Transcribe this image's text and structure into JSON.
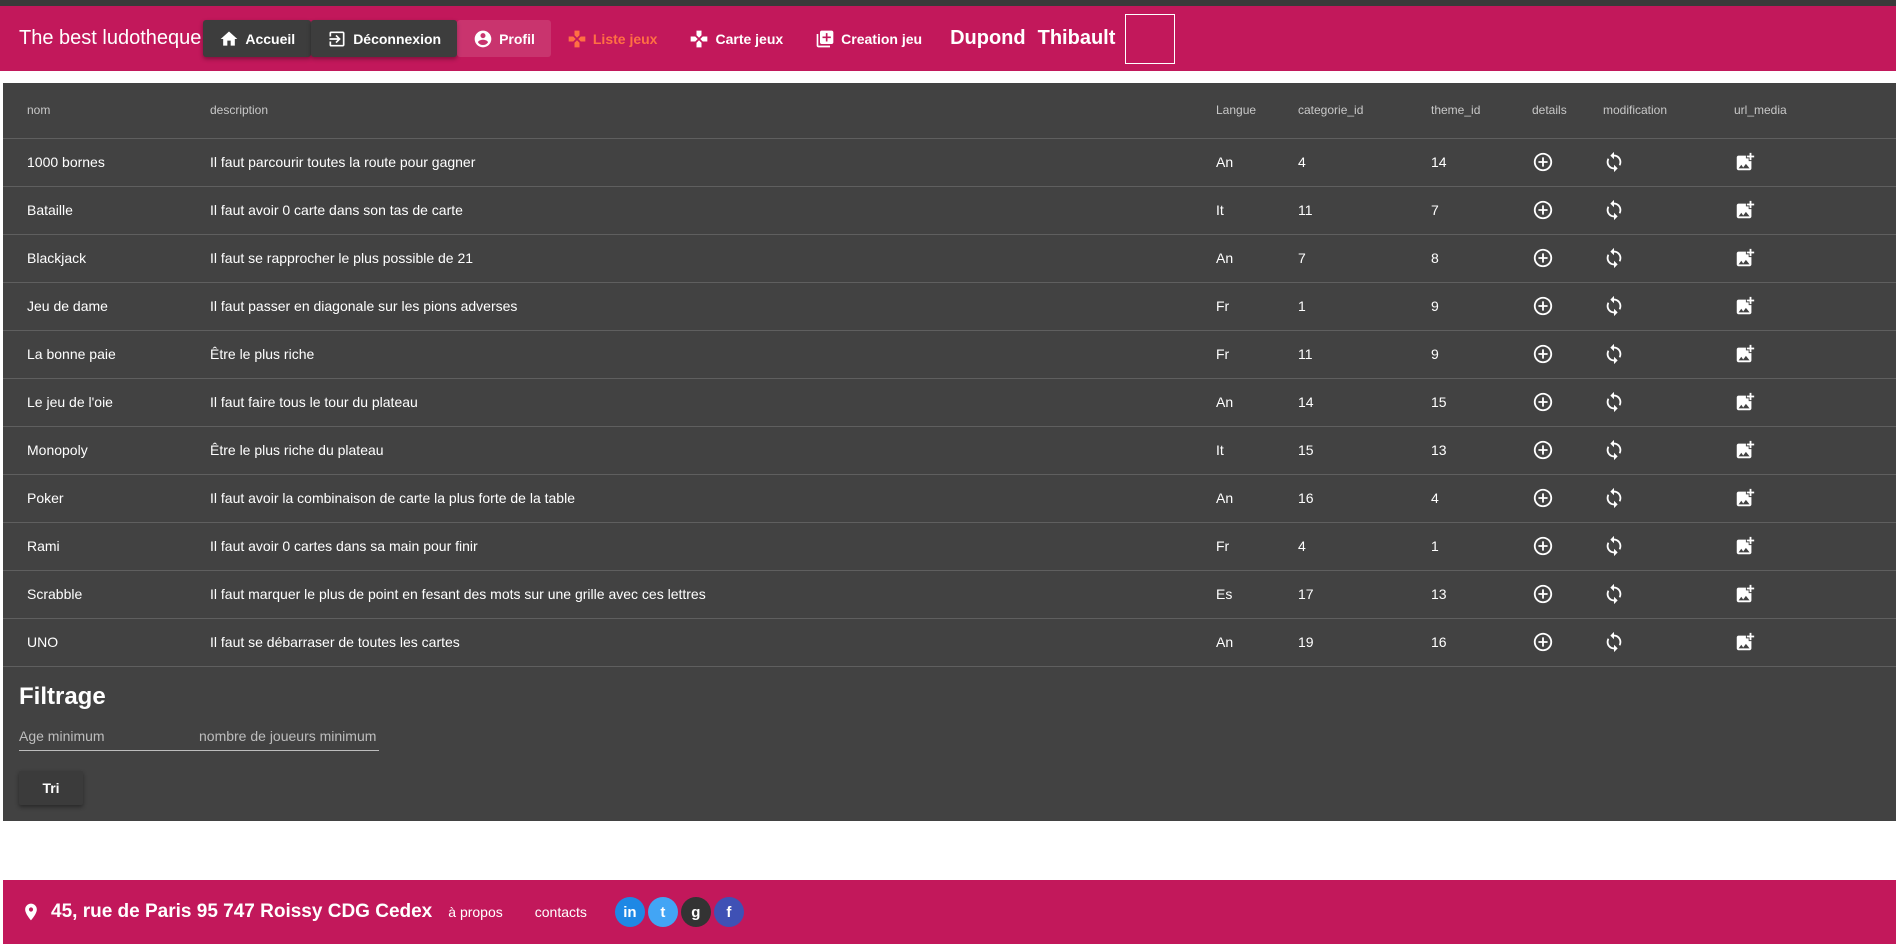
{
  "nav": {
    "brand": "The best ludotheque",
    "items": [
      {
        "label": "Accueil"
      },
      {
        "label": "Déconnexion"
      },
      {
        "label": "Profil"
      },
      {
        "label": "Liste jeux"
      },
      {
        "label": "Carte jeux"
      },
      {
        "label": "Creation jeu"
      }
    ],
    "user_lastname": "Dupond",
    "user_firstname": "Thibault",
    "active_color": "#ff7043"
  },
  "table": {
    "headers": [
      "nom",
      "description",
      "Langue",
      "categorie_id",
      "theme_id",
      "details",
      "modification",
      "url_media"
    ],
    "rows": [
      {
        "nom": "1000 bornes",
        "description": "Il faut parcourir toutes la route pour gagner",
        "langue": "An",
        "categorie_id": "4",
        "theme_id": "14"
      },
      {
        "nom": "Bataille",
        "description": "Il faut avoir 0 carte dans son tas de carte",
        "langue": "It",
        "categorie_id": "11",
        "theme_id": "7"
      },
      {
        "nom": "Blackjack",
        "description": "Il faut se rapprocher le plus possible de 21",
        "langue": "An",
        "categorie_id": "7",
        "theme_id": "8"
      },
      {
        "nom": "Jeu de dame",
        "description": "Il faut passer en diagonale sur les pions adverses",
        "langue": "Fr",
        "categorie_id": "1",
        "theme_id": "9"
      },
      {
        "nom": "La bonne paie",
        "description": "Être le plus riche",
        "langue": "Fr",
        "categorie_id": "11",
        "theme_id": "9"
      },
      {
        "nom": "Le jeu de l'oie",
        "description": "Il faut faire tous le tour du plateau",
        "langue": "An",
        "categorie_id": "14",
        "theme_id": "15"
      },
      {
        "nom": "Monopoly",
        "description": "Être le plus riche du plateau",
        "langue": "It",
        "categorie_id": "15",
        "theme_id": "13"
      },
      {
        "nom": "Poker",
        "description": "Il faut avoir la combinaison de carte la plus forte de la table",
        "langue": "An",
        "categorie_id": "16",
        "theme_id": "4"
      },
      {
        "nom": "Rami",
        "description": "Il faut avoir 0 cartes dans sa main pour finir",
        "langue": "Fr",
        "categorie_id": "4",
        "theme_id": "1"
      },
      {
        "nom": "Scrabble",
        "description": "Il faut marquer le plus de point en fesant des mots sur une grille avec ces lettres",
        "langue": "Es",
        "categorie_id": "17",
        "theme_id": "13"
      },
      {
        "nom": "UNO",
        "description": "Il faut se débarraser de toutes les cartes",
        "langue": "An",
        "categorie_id": "19",
        "theme_id": "16"
      }
    ]
  },
  "filter": {
    "title": "Filtrage",
    "age_placeholder": "Age minimum",
    "players_placeholder": "nombre de joueurs minimum",
    "button_label": "Tri"
  },
  "footer": {
    "address": "45, rue de Paris 95 747 Roissy CDG Cedex",
    "about": "à propos",
    "contacts": "contacts",
    "social": [
      {
        "icon": "linkedin-icon",
        "glyph": "in",
        "color": "#1e88e5"
      },
      {
        "icon": "twitter-icon",
        "glyph": "t",
        "color": "#42a5f5"
      },
      {
        "icon": "github-icon",
        "glyph": "g",
        "color": "#333333"
      },
      {
        "icon": "facebook-icon",
        "glyph": "f",
        "color": "#3f51b5"
      }
    ]
  },
  "colors": {
    "primary": "#c2185b",
    "panel": "#424242"
  }
}
